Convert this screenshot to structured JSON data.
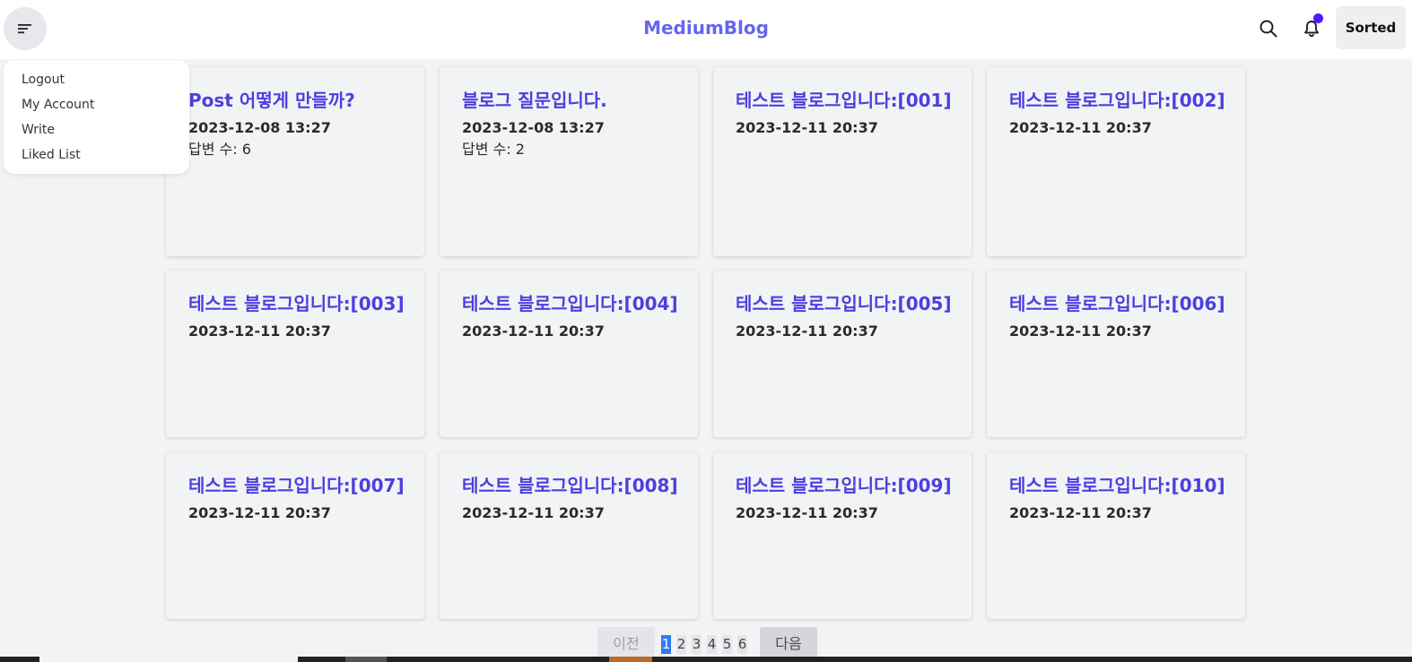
{
  "navbar": {
    "brand": "MediumBlog",
    "sorted_label": "Sorted",
    "icons": [
      "menu-icon",
      "search-icon",
      "bell-icon"
    ],
    "notification_dot_color": "#4b1aff"
  },
  "menu": {
    "items": [
      {
        "label": "Logout"
      },
      {
        "label": "My Account"
      },
      {
        "label": "Write"
      },
      {
        "label": "Liked List"
      }
    ]
  },
  "posts": [
    {
      "title": "Post 어떻게 만들까?",
      "date": "2023-12-08 13:27",
      "answers": "답변 수: 6"
    },
    {
      "title": "블로그 질문입니다.",
      "date": "2023-12-08 13:27",
      "answers": "답변 수: 2"
    },
    {
      "title": "테스트 블로그입니다:[001]",
      "date": "2023-12-11 20:37"
    },
    {
      "title": "테스트 블로그입니다:[002]",
      "date": "2023-12-11 20:37"
    },
    {
      "title": "테스트 블로그입니다:[003]",
      "date": "2023-12-11 20:37"
    },
    {
      "title": "테스트 블로그입니다:[004]",
      "date": "2023-12-11 20:37"
    },
    {
      "title": "테스트 블로그입니다:[005]",
      "date": "2023-12-11 20:37"
    },
    {
      "title": "테스트 블로그입니다:[006]",
      "date": "2023-12-11 20:37"
    },
    {
      "title": "테스트 블로그입니다:[007]",
      "date": "2023-12-11 20:37"
    },
    {
      "title": "테스트 블로그입니다:[008]",
      "date": "2023-12-11 20:37"
    },
    {
      "title": "테스트 블로그입니다:[009]",
      "date": "2023-12-11 20:37"
    },
    {
      "title": "테스트 블로그입니다:[010]",
      "date": "2023-12-11 20:37"
    }
  ],
  "pagination": {
    "prev_label": "이전",
    "next_label": "다음",
    "pages": [
      "1",
      "2",
      "3",
      "4",
      "5",
      "6"
    ],
    "current_page": "1"
  },
  "colors": {
    "brand": "#6366f1",
    "post_title": "#4c3fe0",
    "active_page": "#2f7bf0"
  }
}
